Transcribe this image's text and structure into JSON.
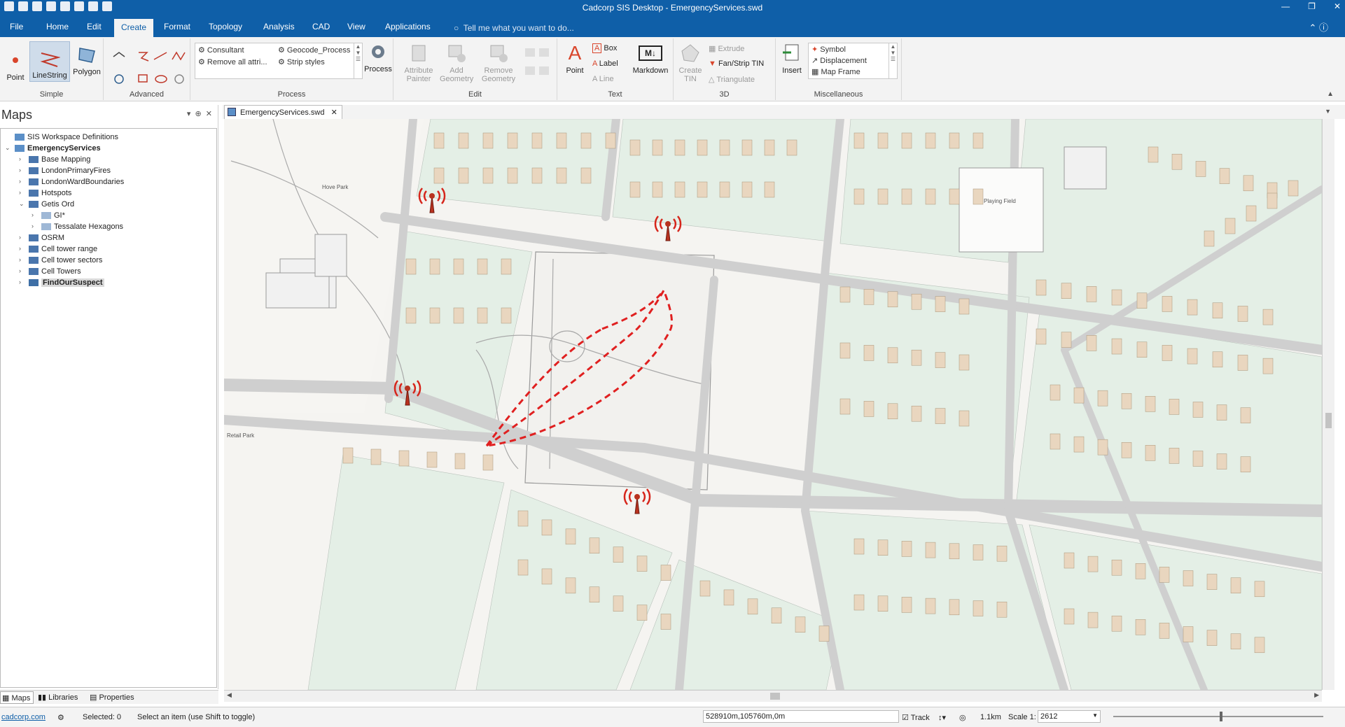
{
  "app": {
    "title": "Cadcorp SIS Desktop - EmergencyServices.swd"
  },
  "tabs": [
    "File",
    "Home",
    "Edit",
    "Create",
    "Format",
    "Topology",
    "Analysis",
    "CAD",
    "View",
    "Applications"
  ],
  "active_tab": "Create",
  "tell_me": "Tell me what you want to do...",
  "ribbon": {
    "simple": {
      "label": "Simple",
      "point": "Point",
      "linestring": "LineString",
      "polygon": "Polygon"
    },
    "advanced": {
      "label": "Advanced"
    },
    "process": {
      "label": "Process",
      "items": [
        "Consultant",
        "Remove all attri...",
        "Geocode_Process",
        "Strip styles"
      ],
      "button": "Process"
    },
    "edit": {
      "label": "Edit",
      "attribute_painter": "Attribute Painter",
      "add_geometry": "Add Geometry",
      "remove_geometry": "Remove Geometry"
    },
    "text": {
      "label": "Text",
      "point": "Point",
      "box": "Box",
      "label_btn": "Label",
      "line": "Line",
      "markdown": "Markdown"
    },
    "three_d": {
      "label": "3D",
      "create_tin": "Create TIN",
      "extrude": "Extrude",
      "fan_strip": "Fan/Strip TIN",
      "triangulate": "Triangulate"
    },
    "misc": {
      "label": "Miscellaneous",
      "insert": "Insert",
      "items": [
        "Symbol",
        "Displacement",
        "Map Frame"
      ]
    }
  },
  "maps_panel": {
    "title": "Maps",
    "tree": [
      {
        "label": "SIS Workspace Definitions",
        "level": 0,
        "toggle": "",
        "bold": false
      },
      {
        "label": "EmergencyServices",
        "level": 0,
        "toggle": "v",
        "bold": true
      },
      {
        "label": "Base Mapping",
        "level": 1,
        "toggle": ">",
        "bold": false
      },
      {
        "label": "LondonPrimaryFires",
        "level": 1,
        "toggle": ">",
        "bold": false
      },
      {
        "label": "LondonWardBoundaries",
        "level": 1,
        "toggle": ">",
        "bold": false
      },
      {
        "label": "Hotspots",
        "level": 1,
        "toggle": ">",
        "bold": false
      },
      {
        "label": "Getis Ord",
        "level": 1,
        "toggle": "v",
        "bold": false
      },
      {
        "label": "GI*",
        "level": 2,
        "toggle": ">",
        "bold": false
      },
      {
        "label": "Tessalate Hexagons",
        "level": 2,
        "toggle": ">",
        "bold": false
      },
      {
        "label": "OSRM",
        "level": 1,
        "toggle": ">",
        "bold": false
      },
      {
        "label": "Cell tower range",
        "level": 1,
        "toggle": ">",
        "bold": false
      },
      {
        "label": "Cell tower sectors",
        "level": 1,
        "toggle": ">",
        "bold": false
      },
      {
        "label": "Cell Towers",
        "level": 1,
        "toggle": ">",
        "bold": false
      },
      {
        "label": "FindOurSuspect",
        "level": 1,
        "toggle": ">",
        "bold": true
      }
    ],
    "bottom_tabs": [
      "Maps",
      "Libraries",
      "Properties"
    ]
  },
  "document_tab": "EmergencyServices.swd",
  "map_labels": [
    "Hove Park",
    "Playing Field",
    "Retail Park"
  ],
  "status": {
    "link": "cadcorp.com",
    "selected": "Selected: 0",
    "hint": "Select an item (use Shift to toggle)",
    "coords": "528910m,105760m,0m",
    "track": "Track",
    "distance": "1.1km",
    "scale_label": "Scale 1:",
    "scale_value": "2612"
  },
  "colors": {
    "accent": "#0f5fa8",
    "building": "#e9d6bf",
    "parcel": "#e4efe6",
    "road": "#d8d8d8",
    "tower": "#c0301e",
    "sector": "#e02020"
  }
}
